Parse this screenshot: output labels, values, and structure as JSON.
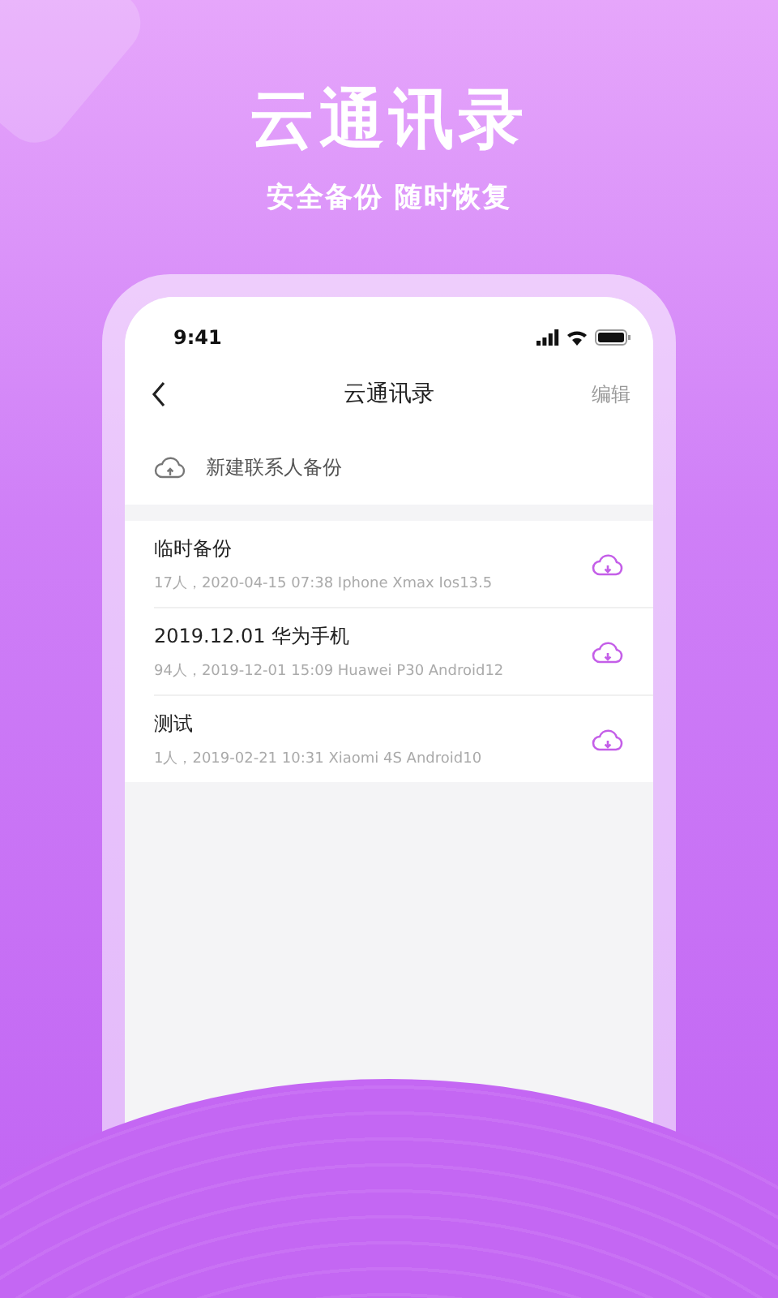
{
  "headline": "云通讯录",
  "subtitle": "安全备份 随时恢复",
  "status_bar": {
    "time": "9:41"
  },
  "nav": {
    "title": "云通讯录",
    "action": "编辑"
  },
  "new_backup": {
    "label": "新建联系人备份"
  },
  "backups": [
    {
      "title": "临时备份",
      "detail": "17人，2020-04-15 07:38 Iphone Xmax Ios13.5"
    },
    {
      "title": "2019.12.01 华为手机",
      "detail": "94人，2019-12-01 15:09 Huawei P30 Android12"
    },
    {
      "title": "测试",
      "detail": "1人，2019-02-21 10:31 Xiaomi 4S Android10"
    }
  ]
}
